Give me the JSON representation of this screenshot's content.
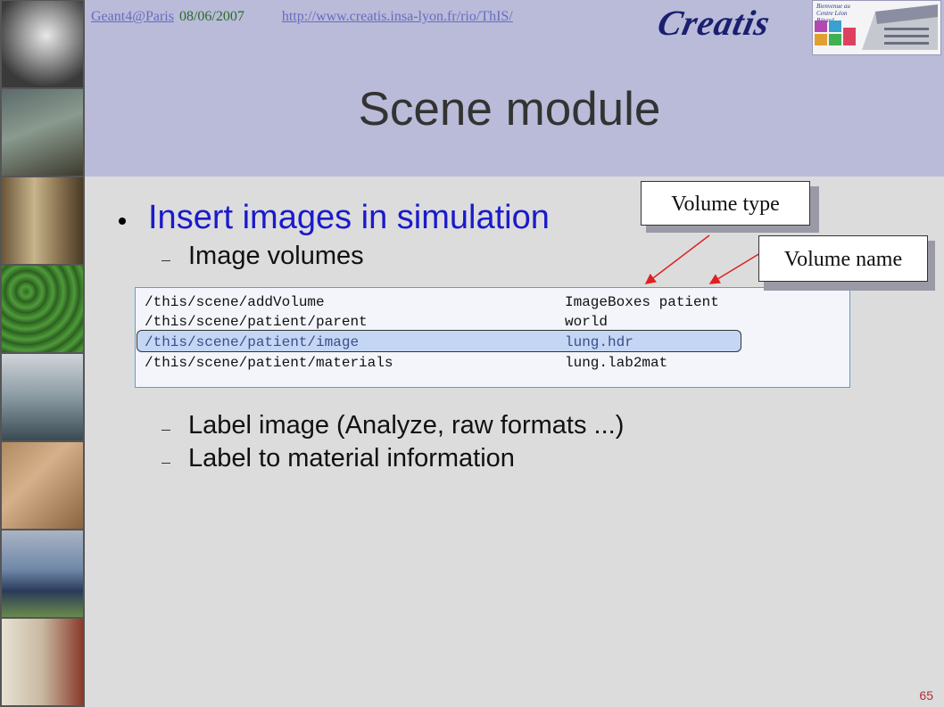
{
  "header": {
    "author_link": "Geant4@Paris",
    "date": "08/06/2007",
    "site_link": "http://www.creatis.insa-lyon.fr/rio/ThIS/",
    "logo_text": "Creatis",
    "building_caption": "Bienvenue au Centre Léon Bérard"
  },
  "title": "Scene module",
  "bullets": {
    "main": "Insert images in simulation",
    "sub1": "Image volumes",
    "sub2": "Label image (Analyze, raw formats ...)",
    "sub3": "Label to material information"
  },
  "code_lines": [
    {
      "command": "/this/scene/addVolume",
      "value": "ImageBoxes patient"
    },
    {
      "command": "/this/scene/patient/parent",
      "value": "world"
    },
    {
      "command": "/this/scene/patient/image",
      "value": "lung.hdr"
    },
    {
      "command": "/this/scene/patient/materials",
      "value": "lung.lab2mat"
    }
  ],
  "callouts": {
    "volume_type": "Volume type",
    "volume_name": "Volume name"
  },
  "slide_number": "65",
  "colors": {
    "title_band": "#b9bbd9",
    "slide_background": "#dcdcdc",
    "bullet_blue": "#1a1acc",
    "arrow_red": "#e02020",
    "code_border": "#4ea4d3",
    "highlight": "#c4d6f4"
  }
}
